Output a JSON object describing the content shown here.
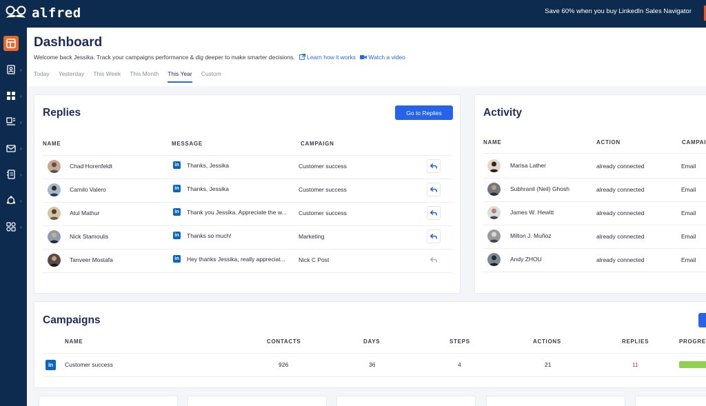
{
  "app": {
    "logo_text": "alfred",
    "promo": "Save 60% when you buy LinkedIn Sales Navigator",
    "accent": "#e8692c",
    "nav_bg": "#0d2b4e",
    "primary": "#2563eb"
  },
  "sidebar": {
    "items": [
      {
        "icon": "dashboard-icon",
        "active": true
      },
      {
        "icon": "contacts-icon"
      },
      {
        "icon": "grid-icon"
      },
      {
        "icon": "campaigns-icon"
      },
      {
        "icon": "inbox-icon"
      },
      {
        "icon": "templates-icon"
      },
      {
        "icon": "network-icon"
      },
      {
        "icon": "integrations-icon"
      }
    ]
  },
  "header": {
    "title": "Dashboard",
    "subtitle": "Welcome back Jessika. Track your campaigns performance & dig deeper to make smarter decisions.",
    "learn_link": "Learn how it works",
    "video_link": "Watch a video",
    "tabs": [
      "Today",
      "Yesterday",
      "This Week",
      "This Month",
      "This Year",
      "Custom"
    ],
    "active_tab": "This Year"
  },
  "replies": {
    "title": "Replies",
    "button": "Go to Replies",
    "columns": [
      "NAME",
      "MESSAGE",
      "CAMPAIGN"
    ],
    "rows": [
      {
        "name": "Chad Horenfeldt",
        "message": "Thanks, Jessika",
        "campaign": "Customer success"
      },
      {
        "name": "Camilo Valero",
        "message": "Thanks, Jessika",
        "campaign": "Customer success"
      },
      {
        "name": "Atul Mathur",
        "message": "Thank you Jessika. Appreciate the w...",
        "campaign": "Customer success"
      },
      {
        "name": "Nick Stamoulis",
        "message": "Thanks so much!",
        "campaign": "Marketing"
      },
      {
        "name": "Tanveer Mostafa",
        "message": "Hey thanks Jessika, really appreciat...",
        "campaign": "Nick C Post"
      }
    ]
  },
  "activity": {
    "title": "Activity",
    "columns": [
      "NAME",
      "ACTION",
      "CAMPAI"
    ],
    "rows": [
      {
        "name": "Marisa Lather",
        "action": "already connected",
        "campaign": "Email"
      },
      {
        "name": "Subhranil (Neil) Ghosh",
        "action": "already connected",
        "campaign": "Email"
      },
      {
        "name": "James W. Hewitt",
        "action": "already connected",
        "campaign": "Email"
      },
      {
        "name": "Milton J. Muñoz",
        "action": "already connected",
        "campaign": "Email"
      },
      {
        "name": "Andy ZHOU",
        "action": "already connected",
        "campaign": "Email"
      }
    ]
  },
  "campaigns": {
    "title": "Campaigns",
    "columns": [
      "NAME",
      "CONTACTS",
      "DAYS",
      "STEPS",
      "ACTIONS",
      "REPLIES",
      "PROGRE"
    ],
    "rows": [
      {
        "name": "Customer success",
        "contacts": "926",
        "days": "36",
        "steps": "4",
        "actions": "21",
        "replies": "11"
      }
    ]
  }
}
